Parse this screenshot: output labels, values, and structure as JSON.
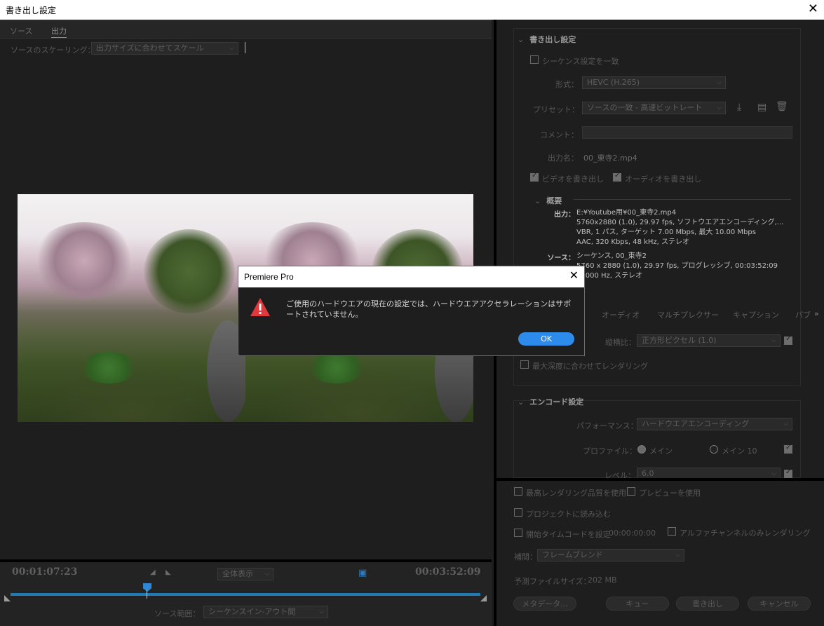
{
  "window": {
    "title": "書き出し設定",
    "close": "✕"
  },
  "left": {
    "tabs": [
      "ソース",
      "出力"
    ],
    "scaling_label": "ソースのスケーリング：",
    "scaling_value": "出力サイズに合わせてスケール",
    "timecode_in": "00:01:07:23",
    "timecode_out": "00:03:52:09",
    "zoom_value": "全体表示",
    "source_range_label": "ソース範囲：",
    "source_range_value": "シーケンスイン-アウト間"
  },
  "right": {
    "export_settings_title": "書き出し設定",
    "match_sequence": "シーケンス設定を一致",
    "format_label": "形式：",
    "format_value": "HEVC (H.265)",
    "preset_label": "プリセット：",
    "preset_value": "ソースの一致 - 高速ビットレート",
    "comment_label": "コメント：",
    "output_name_label": "出力名：",
    "output_name_value": "00_東寺2.mp4",
    "export_video": "ビデオを書き出し",
    "export_audio": "オーディオを書き出し",
    "summary_title": "概要",
    "summary_output_key": "出力：",
    "summary_output": [
      "E:¥Youtube用¥00_東寺2.mp4",
      "5760x2880 (1.0), 29.97 fps, ソフトウエアエンコーディング,...",
      "VBR, 1 パス, ターゲット 7.00 Mbps, 最大 10.00 Mbps",
      "AAC, 320 Kbps, 48 kHz, ステレオ"
    ],
    "summary_source_key": "ソース：",
    "summary_source": [
      "シーケンス, 00_東寺2",
      "5760 x 2880 (1.0), 29.97 fps, プログレッシブ, 00:03:52:09",
      "48000 Hz, ステレオ"
    ],
    "tabs": [
      "オーディオ",
      "マルチプレクサー",
      "キャプション",
      "パブ"
    ],
    "tabs_more": "»",
    "aspect_label": "縦横比：",
    "aspect_value": "正方形ピクセル (1.0)",
    "max_depth": "最大深度に合わせてレンダリング",
    "encode_title": "エンコード設定",
    "perf_label": "パフォーマンス：",
    "perf_value": "ハードウエアエンコーディング",
    "profile_label": "プロファイル：",
    "profile_main": "メイン",
    "profile_main10": "メイン 10",
    "level_label": "レベル：",
    "level_value": "6.0",
    "max_quality": "最高レンダリング品質を使用",
    "use_preview": "プレビューを使用",
    "import_project": "プロジェクトに読み込む",
    "set_timecode": "開始タイムコードを設定",
    "timecode_value": "00:00:00:00",
    "alpha_only": "アルファチャンネルのみレンダリング",
    "interp_label": "補間：",
    "interp_value": "フレームブレンド",
    "filesize_label": "予測ファイルサイズ：",
    "filesize_value": "202 MB",
    "btn_metadata": "メタデータ...",
    "btn_queue": "キュー",
    "btn_export": "書き出し",
    "btn_cancel": "キャンセル"
  },
  "dialog": {
    "title": "Premiere Pro",
    "close": "✕",
    "message": "ご使用のハードウエアの現在の設定では、ハードウエアアクセラレーションはサポートされていません。",
    "ok": "OK"
  }
}
